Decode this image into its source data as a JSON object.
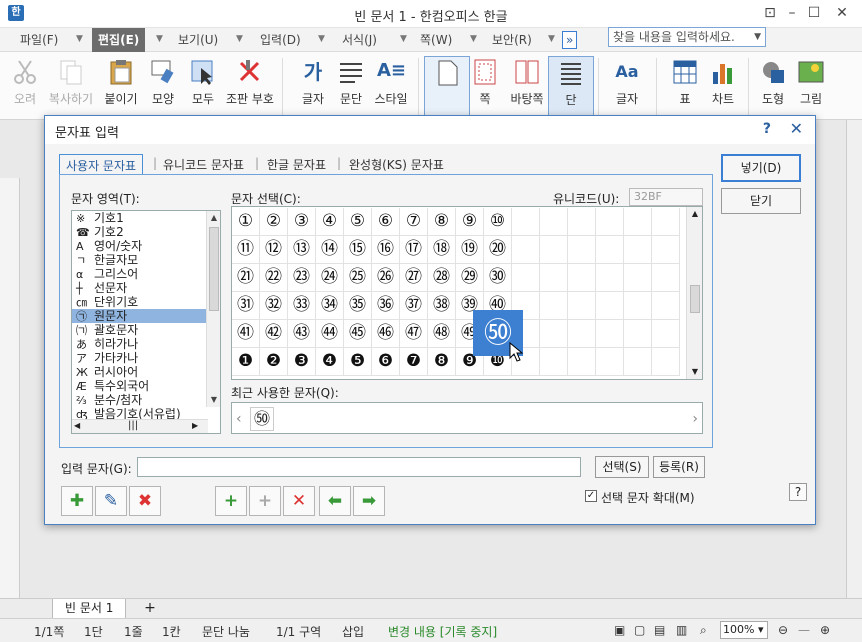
{
  "window": {
    "title": "빈 문서 1 - 한컴오피스 한글",
    "logo": "한"
  },
  "menu": {
    "items": [
      "파일(F)",
      "편집(E)",
      "보기(U)",
      "입력(D)",
      "서식(J)",
      "쪽(W)",
      "보안(R)"
    ],
    "active_index": 1,
    "search_placeholder": "찾을 내용을 입력하세요."
  },
  "ribbon": {
    "buttons": [
      {
        "label": "오려\n두기",
        "icon": "scissors-icon",
        "disabled": true
      },
      {
        "label": "복사하기",
        "icon": "copy-icon",
        "disabled": true
      },
      {
        "label": "붙이기",
        "icon": "paste-icon",
        "disabled": false
      },
      {
        "label": "모양\n복사",
        "icon": "format-painter-icon",
        "disabled": false
      },
      {
        "label": "모두\n선택",
        "icon": "select-all-icon",
        "disabled": false
      },
      {
        "label": "조판 부호\n지우기",
        "icon": "clear-format-icon",
        "disabled": false
      },
      {
        "label": "글자\n모양",
        "icon": "char-shape-icon",
        "disabled": false
      },
      {
        "label": "문단\n모양",
        "icon": "para-shape-icon",
        "disabled": false
      },
      {
        "label": "스타일",
        "icon": "style-icon",
        "disabled": false
      },
      {
        "label": "쪽\n여백",
        "icon": "page-margin-icon",
        "disabled": false
      },
      {
        "label": "바탕쪽",
        "icon": "master-page-icon",
        "disabled": false
      },
      {
        "label": "단",
        "icon": "column-icon",
        "disabled": false
      },
      {
        "label": "글자\n바꾸기",
        "icon": "replace-char-icon",
        "disabled": false
      },
      {
        "label": "표",
        "icon": "table-icon",
        "disabled": false
      },
      {
        "label": "차트",
        "icon": "chart-icon",
        "disabled": false
      },
      {
        "label": "도형",
        "icon": "shape-icon",
        "disabled": false
      },
      {
        "label": "그림",
        "icon": "picture-icon",
        "disabled": false
      }
    ]
  },
  "dialog": {
    "title": "문자표 입력",
    "help": "?",
    "close": "✕",
    "tabs": [
      "사용자 문자표",
      "유니코드 문자표",
      "한글 문자표",
      "완성형(KS) 문자표"
    ],
    "active_tab": 0,
    "area_label": "문자 영역(T):",
    "areas": [
      {
        "icon": "※",
        "label": "기호1"
      },
      {
        "icon": "☎",
        "label": "기호2"
      },
      {
        "icon": "A",
        "label": "영어/숫자"
      },
      {
        "icon": "ㄱ",
        "label": "한글자모"
      },
      {
        "icon": "α",
        "label": "그리스어"
      },
      {
        "icon": "┼",
        "label": "선문자"
      },
      {
        "icon": "㎝",
        "label": "단위기호"
      },
      {
        "icon": "㉠",
        "label": "원문자"
      },
      {
        "icon": "㈀",
        "label": "괄호문자"
      },
      {
        "icon": "あ",
        "label": "히라가나"
      },
      {
        "icon": "ア",
        "label": "가타카나"
      },
      {
        "icon": "Ж",
        "label": "러시아어"
      },
      {
        "icon": "Æ",
        "label": "특수외국어"
      },
      {
        "icon": "⅔",
        "label": "분수/첨자"
      },
      {
        "icon": "ʤ",
        "label": "발음기호(서유럽)"
      }
    ],
    "selected_area": 7,
    "select_label": "문자 선택(C):",
    "unicode_label": "유니코드(U):",
    "unicode_value": "32BF",
    "grid_rows": [
      [
        "①",
        "②",
        "③",
        "④",
        "⑤",
        "⑥",
        "⑦",
        "⑧",
        "⑨",
        "⑩"
      ],
      [
        "⑪",
        "⑫",
        "⑬",
        "⑭",
        "⑮",
        "⑯",
        "⑰",
        "⑱",
        "⑲",
        "⑳"
      ],
      [
        "㉑",
        "㉒",
        "㉓",
        "㉔",
        "㉕",
        "㉖",
        "㉗",
        "㉘",
        "㉙",
        "㉚"
      ],
      [
        "㉛",
        "㉜",
        "㉝",
        "㉞",
        "㉟",
        "㊱",
        "㊲",
        "㊳",
        "㊴",
        "㊵"
      ],
      [
        "㊶",
        "㊷",
        "㊸",
        "㊹",
        "㊺",
        "㊻",
        "㊼",
        "㊽",
        "㊾",
        "㊿"
      ],
      [
        "❶",
        "❷",
        "❸",
        "❹",
        "❺",
        "❻",
        "❼",
        "❽",
        "❾",
        "❿"
      ]
    ],
    "zoom_char": "㊿",
    "recent_label": "최근 사용한 문자(Q):",
    "recent_chars": [
      "㊿"
    ],
    "input_label": "입력 문자(G):",
    "input_value": "",
    "select_button": "선택(S)",
    "register_button": "등록(R)",
    "insert_button": "넣기(D)",
    "close_button": "닫기",
    "zoom_checkbox_label": "선택 문자 확대(M)",
    "zoom_checked": true
  },
  "tabs_bar": {
    "doc_tab": "빈 문서 1",
    "add": "+"
  },
  "status": {
    "page": "1/1쪽",
    "section": "1단",
    "line": "1줄",
    "col": "1칸",
    "break": "문단 나눔",
    "area": "1/1 구역",
    "mode": "삽입",
    "track": "변경 내용 [기록 중지]",
    "zoom": "100%"
  }
}
